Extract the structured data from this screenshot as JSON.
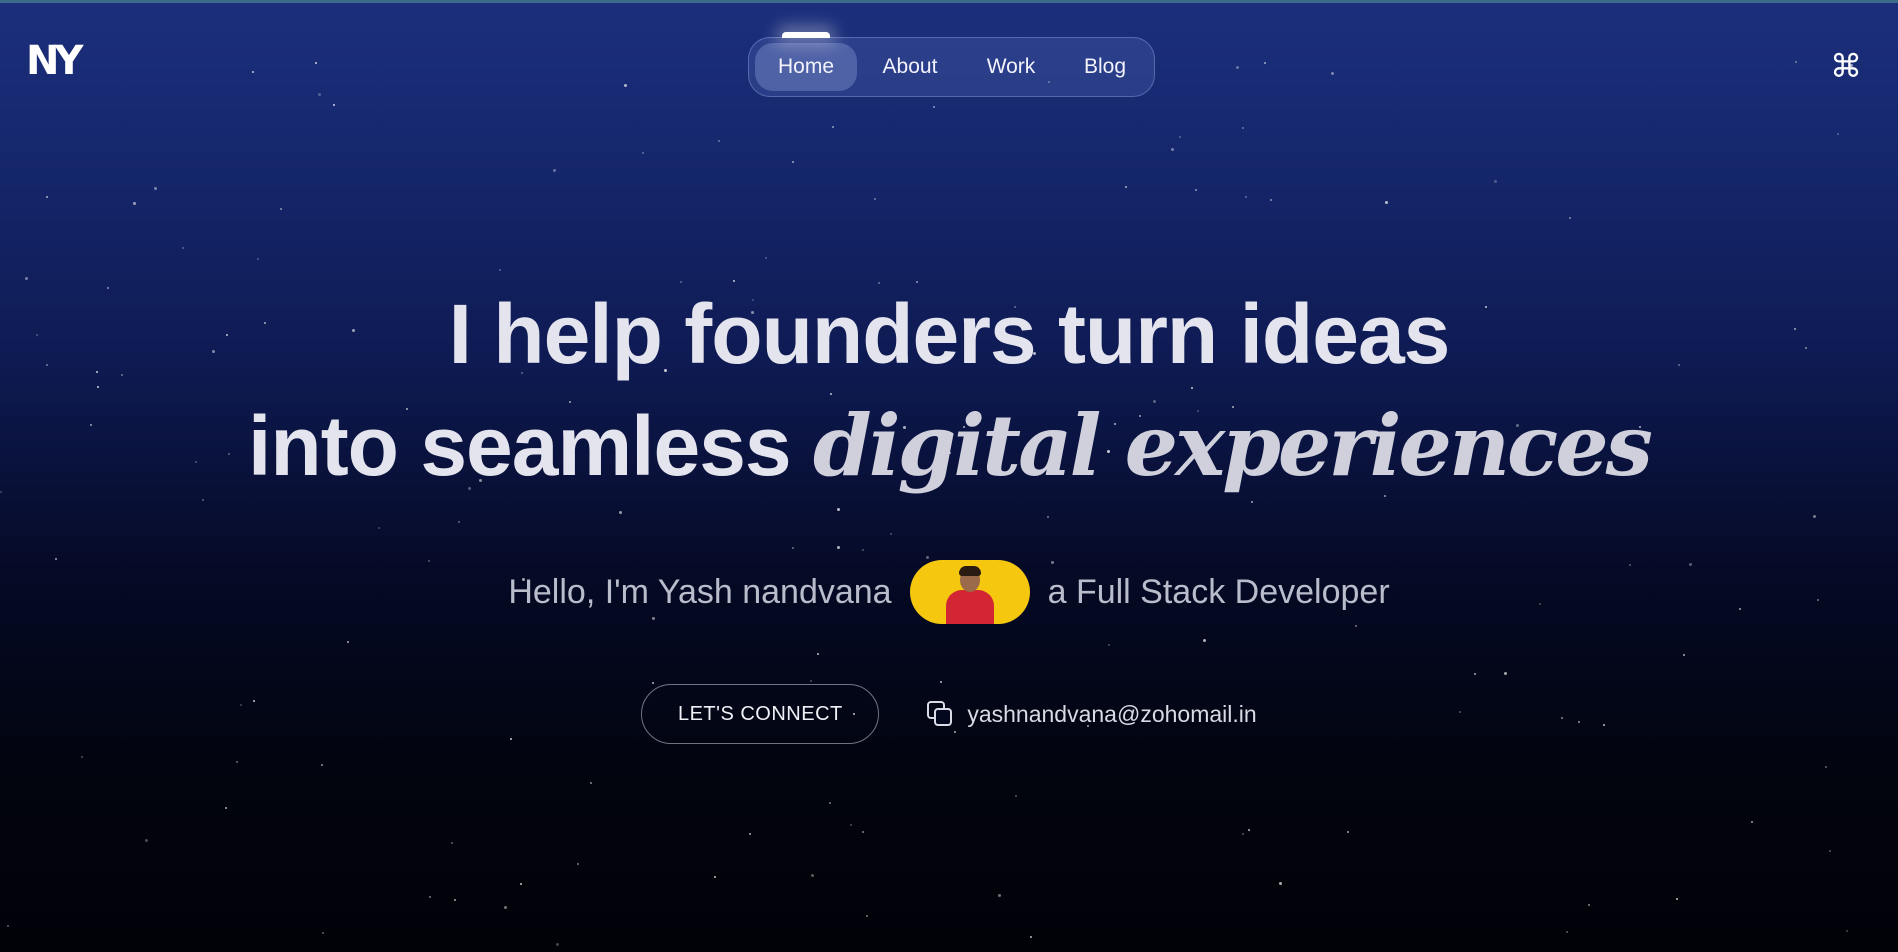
{
  "header": {
    "logo_text": "NY",
    "nav": {
      "items": [
        {
          "label": "Home",
          "active": true
        },
        {
          "label": "About",
          "active": false
        },
        {
          "label": "Work",
          "active": false
        },
        {
          "label": "Blog",
          "active": false
        }
      ]
    },
    "command_icon": "command-key-icon",
    "command_glyph": "⌘"
  },
  "hero": {
    "headline_line1": "I help founders turn ideas",
    "headline_line2_plain": "into seamless",
    "headline_line2_accent": "digital experiences",
    "intro_before": "Hello, I'm Yash nandvana",
    "intro_after": "a Full Stack Developer",
    "avatar_bg_color": "#f6c70f",
    "cta_label": "LET'S CONNECT",
    "email": "yashnandvana@zohomail.in",
    "email_icon": "copy-icon"
  },
  "colors": {
    "background_top": "#1c2f7c",
    "background_bottom": "#010208",
    "text_primary": "#e4e4ee"
  }
}
